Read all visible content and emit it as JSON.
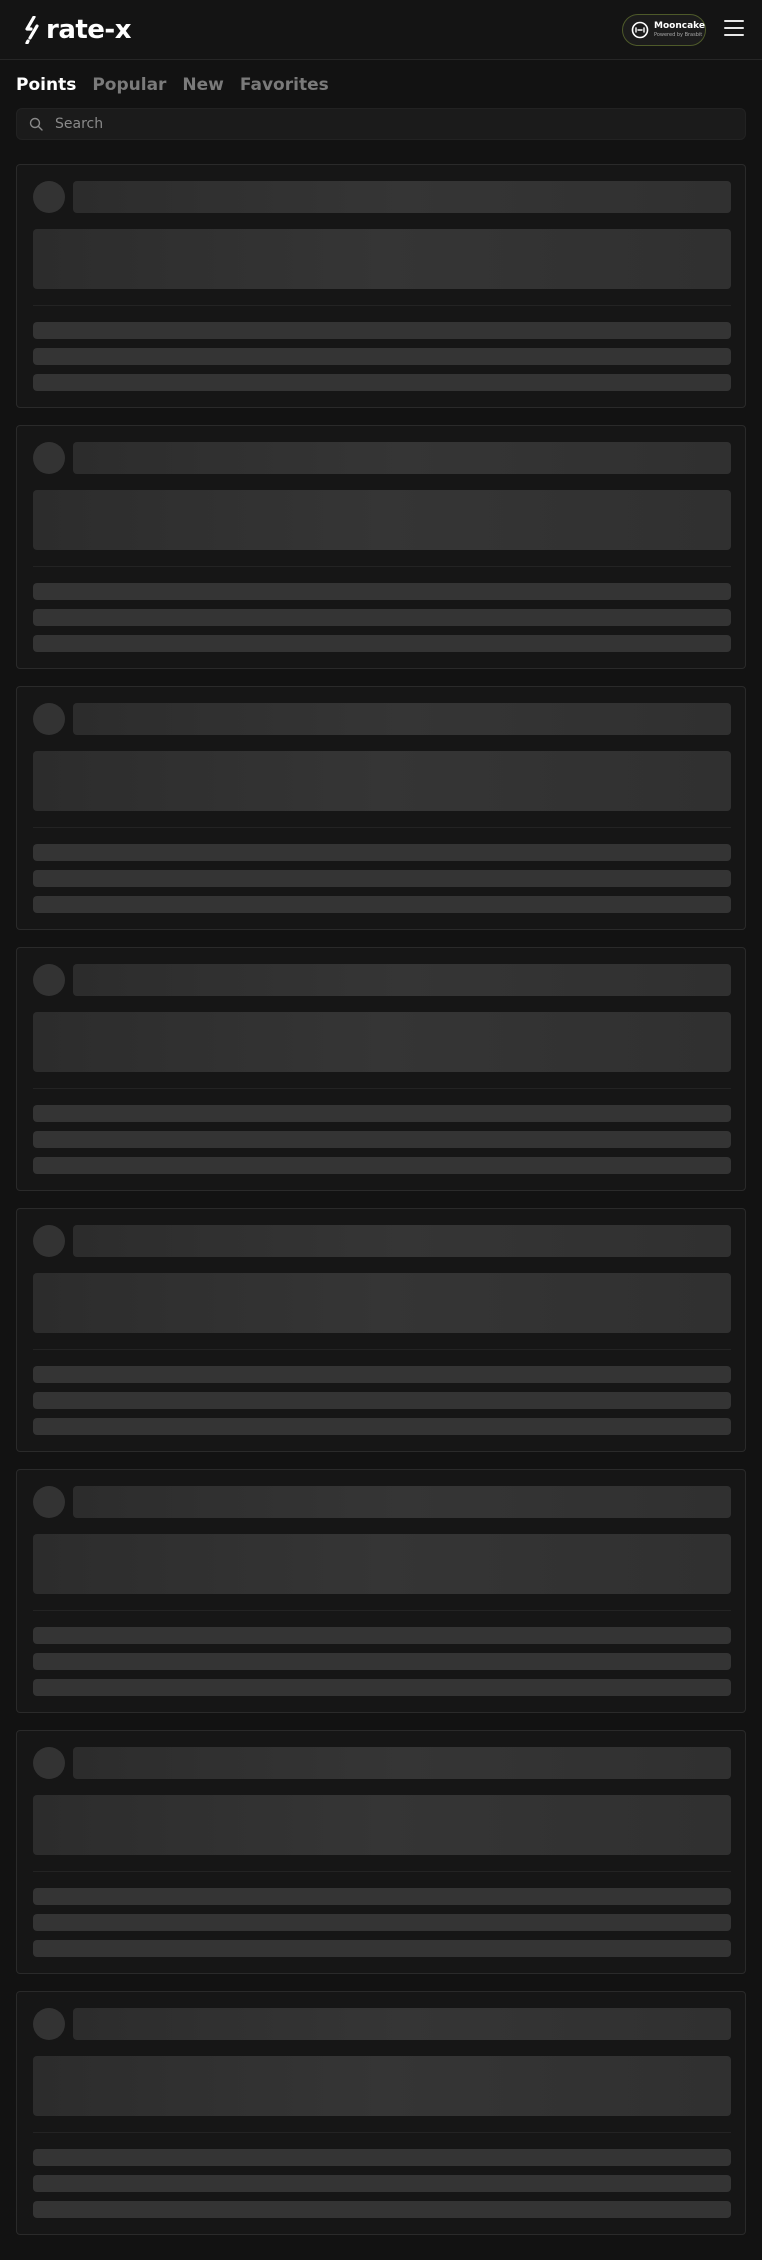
{
  "header": {
    "logo_text": "rate-x",
    "badge": {
      "title": "Mooncake",
      "subtitle": "Powered by Brasbit"
    }
  },
  "tabs": [
    {
      "label": "Points",
      "active": true
    },
    {
      "label": "Popular",
      "active": false
    },
    {
      "label": "New",
      "active": false
    },
    {
      "label": "Favorites",
      "active": false
    }
  ],
  "search": {
    "placeholder": "Search",
    "value": ""
  },
  "colors": {
    "background": "#121212",
    "card": "#161616",
    "skeleton": "#333333",
    "badge_border": "#4e5a2a",
    "tab_active": "#ffffff",
    "tab_inactive": "#7a7a7a"
  },
  "icons": [
    "logo-mark-icon",
    "mooncake-icon",
    "menu-icon",
    "search-icon"
  ],
  "loading_cards": 8
}
